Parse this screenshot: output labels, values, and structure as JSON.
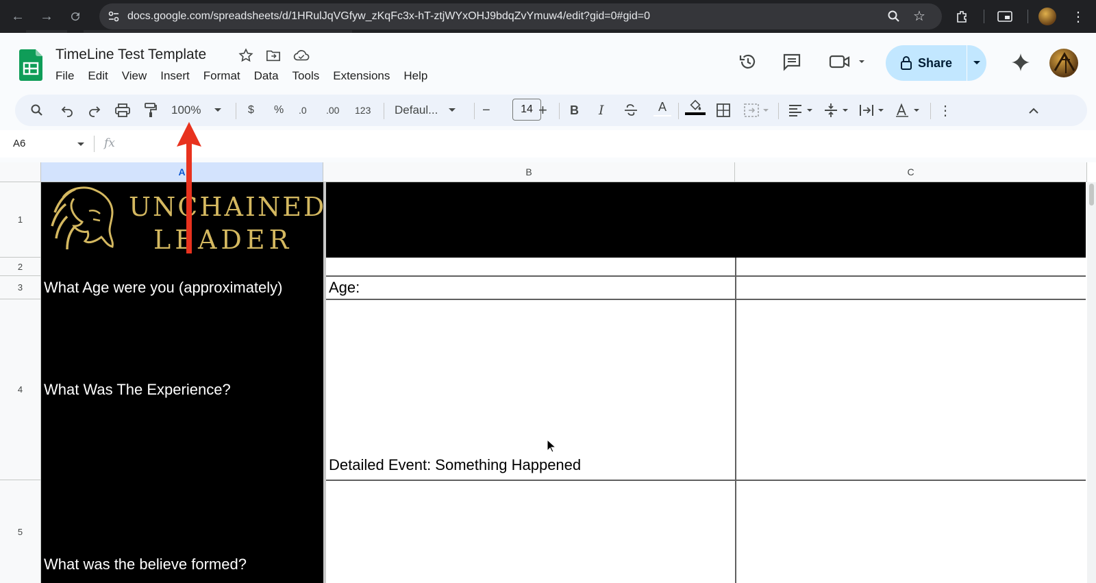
{
  "browser": {
    "url": "docs.google.com/spreadsheets/d/1HRulJqVGfyw_zKqFc3x-hT-ztjWYxOHJ9bdqZvYmuw4/edit?gid=0#gid=0"
  },
  "doc": {
    "title": "TimeLine Test Template",
    "menu": [
      "File",
      "Edit",
      "View",
      "Insert",
      "Format",
      "Data",
      "Tools",
      "Extensions",
      "Help"
    ],
    "share_label": "Share"
  },
  "toolbar": {
    "zoom": "100%",
    "currency": "$",
    "percent": "%",
    "decrease_decimal": ".0",
    "increase_decimal": ".00",
    "number_format": "123",
    "font": "Defaul...",
    "font_size": "14",
    "minus": "−",
    "plus": "+",
    "bold": "B",
    "italic": "I",
    "text_color": "A"
  },
  "formula_bar": {
    "name_box": "A6",
    "fx": "fx"
  },
  "grid": {
    "columns": [
      "A",
      "B",
      "C"
    ],
    "rows": [
      "1",
      "2",
      "3",
      "4",
      "5"
    ],
    "logo": {
      "line1": "UNCHAINED",
      "line2": "LEADER"
    },
    "cells": {
      "A3": "What Age were you (approximately)",
      "A4": "What Was The Experience?",
      "A5": "What was the believe formed?",
      "B3": "Age:",
      "B4": "Detailed Event: Something Happened"
    }
  },
  "colors": {
    "share_bg": "#c2e7ff",
    "toolbar_bg": "#edf2fa",
    "cell_black": "#000000",
    "logo_gold": "#d4b860",
    "arrow_red": "#e8321e",
    "selected_col": "#d3e3fd"
  }
}
